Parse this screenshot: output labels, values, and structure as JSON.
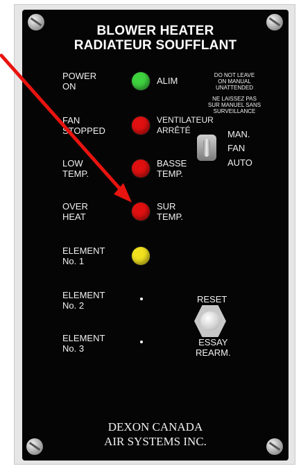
{
  "header": {
    "title_en": "BLOWER HEATER",
    "title_fr": "RADIATEUR SOUFFLANT"
  },
  "indicators": [
    {
      "label_en": "POWER\nON",
      "label_fr": "ALIM",
      "color": "#3fd23f"
    },
    {
      "label_en": "FAN\nSTOPPED",
      "label_fr": "VENTILATEUR\nARRÊTÉ",
      "color": "#e01010"
    },
    {
      "label_en": "LOW\nTEMP.",
      "label_fr": "BASSE\nTEMP.",
      "color": "#e01010"
    },
    {
      "label_en": "OVER\nHEAT",
      "label_fr": "SUR\nTEMP.",
      "color": "#e01010"
    },
    {
      "label_en": "ELEMENT\nNo. 1",
      "label_fr": "",
      "color": "#f0e020"
    },
    {
      "label_en": "ELEMENT\nNo. 2",
      "label_fr": "",
      "color": "#ffffff"
    },
    {
      "label_en": "ELEMENT\nNo. 3",
      "label_fr": "",
      "color": "#ffffff"
    }
  ],
  "warning": {
    "en": "DO NOT LEAVE\nON MANUAL\nUNATTENDED",
    "fr": "NE LAISSEZ PAS\nSUR MANUEL SANS\nSURVEILLANCE"
  },
  "switch": {
    "man": "MAN.",
    "fan": "FAN",
    "auto": "AUTO"
  },
  "reset": {
    "label_en": "RESET",
    "label_fr": "ESSAY\nREARM."
  },
  "brand": {
    "line1": "DEXON CANADA",
    "line2": "AIR SYSTEMS INC."
  },
  "annotation": {
    "arrow_color": "#e8140f"
  }
}
